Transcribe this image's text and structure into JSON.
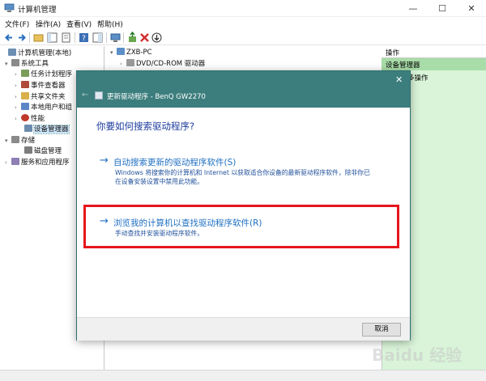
{
  "window": {
    "title": "计算机管理",
    "minimize": "—",
    "maximize": "☐",
    "close": "✕"
  },
  "menu": [
    "文件(F)",
    "操作(A)",
    "查看(V)",
    "帮助(H)"
  ],
  "tree": [
    {
      "label": "计算机管理(本地)",
      "twisty": "",
      "color": "#6d8fb3"
    },
    {
      "label": "系统工具",
      "twisty": "▾",
      "color": "#8a8a8a"
    },
    {
      "label": "任务计划程序",
      "twisty": "›",
      "color": "#7b9c5b"
    },
    {
      "label": "事件查看器",
      "twisty": "›",
      "color": "#b04a3a"
    },
    {
      "label": "共享文件夹",
      "twisty": "›",
      "color": "#d8b14a"
    },
    {
      "label": "本地用户和组",
      "twisty": "›",
      "color": "#5a86c6"
    },
    {
      "label": "性能",
      "twisty": "›",
      "color": "#c0392b"
    },
    {
      "label": "设备管理器",
      "twisty": "",
      "color": "#6b8cae"
    },
    {
      "label": "存储",
      "twisty": "▾",
      "color": "#8a8a8a"
    },
    {
      "label": "磁盘管理",
      "twisty": "",
      "color": "#7d7d7d"
    },
    {
      "label": "服务和应用程序",
      "twisty": "›",
      "color": "#8e7fb5"
    }
  ],
  "device_tree": [
    {
      "label": "ZXB-PC",
      "twisty": "▾"
    },
    {
      "label": "DVD/CD-ROM 驱动器",
      "twisty": "›"
    }
  ],
  "actions": {
    "header": "操作",
    "selected": "设备管理器",
    "more": "多操作"
  },
  "dialog": {
    "title": "更新驱动程序 - BenQ GW2270",
    "close": "✕",
    "back": "←",
    "question": "你要如何搜索驱动程序?",
    "options": [
      {
        "arrow": "→",
        "title": "自动搜索更新的驱动程序软件(S)",
        "desc": "Windows 将搜索你的计算机和 Internet 以获取适合你设备的最新驱动程序软件，除非你已在设备安装设置中禁用此功能。"
      },
      {
        "arrow": "→",
        "title": "浏览我的计算机以查找驱动程序软件(R)",
        "desc": "手动查找并安装驱动程序软件。"
      }
    ],
    "cancel": "取消"
  },
  "colors": {
    "header": "#3c7e7d",
    "link": "#1f6fc1",
    "highlight": "#e5161b",
    "action_pane": "#d9f4d9"
  },
  "watermark": "Baidu 经验"
}
